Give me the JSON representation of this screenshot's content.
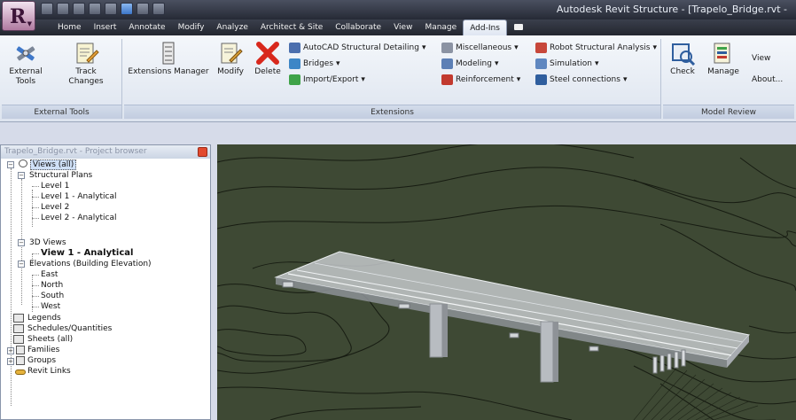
{
  "app": {
    "title": "Autodesk Revit Structure - [Trapelo_Bridge.rvt -"
  },
  "colors": {
    "viewport_bg": "#3f4a35",
    "active_tab_bg": "#e8edf6",
    "close_button": "#e24a2f"
  },
  "tabs": [
    {
      "label": "Home"
    },
    {
      "label": "Insert"
    },
    {
      "label": "Annotate"
    },
    {
      "label": "Modify"
    },
    {
      "label": "Analyze"
    },
    {
      "label": "Architect & Site"
    },
    {
      "label": "Collaborate"
    },
    {
      "label": "View"
    },
    {
      "label": "Manage"
    },
    {
      "label": "Add-Ins",
      "active": true
    }
  ],
  "ribbon": {
    "external_tools_panel": {
      "label": "External Tools",
      "external_tools": {
        "label": "External\nTools",
        "icon": "tools-icon"
      },
      "track_changes": {
        "label": "Track\nChanges",
        "icon": "track-changes-icon"
      }
    },
    "extensions_panel": {
      "label": "Extensions",
      "extensions_manager": {
        "label": "Extensions Manager",
        "icon": "extensions-manager-icon"
      },
      "modify": {
        "label": "Modify",
        "icon": "modify-icon"
      },
      "delete": {
        "label": "Delete",
        "icon": "delete-x-icon"
      },
      "autocad": {
        "label": "AutoCAD Structural Detailing",
        "icon": "autocad-icon"
      },
      "bridges": {
        "label": "Bridges",
        "icon": "bridges-icon"
      },
      "import_export": {
        "label": "Import/Export",
        "icon": "import-export-icon"
      },
      "misc": {
        "label": "Miscellaneous",
        "icon": "miscellaneous-icon"
      },
      "modeling": {
        "label": "Modeling",
        "icon": "modeling-icon"
      },
      "reinforcement": {
        "label": "Reinforcement",
        "icon": "reinforcement-icon"
      },
      "robot": {
        "label": "Robot Structural Analysis",
        "icon": "robot-icon"
      },
      "simulation": {
        "label": "Simulation",
        "icon": "simulation-icon"
      },
      "steel": {
        "label": "Steel connections",
        "icon": "steel-connections-icon"
      }
    },
    "model_review_panel": {
      "label": "Model Review",
      "check": {
        "label": "Check",
        "icon": "check-icon"
      },
      "manage": {
        "label": "Manage",
        "icon": "manage-icon"
      },
      "view": {
        "label": "View\nAbout..."
      }
    }
  },
  "browser": {
    "title": "Trapelo_Bridge.rvt - Project browser",
    "views_all": "Views (all)",
    "structural_plans": "Structural Plans",
    "level1": "Level 1",
    "level1_analytical": "Level 1 - Analytical",
    "level2": "Level 2",
    "level2_analytical": "Level 2 - Analytical",
    "views_3d": "3D Views",
    "view1_analytical": "View 1 - Analytical",
    "elevations": "Elevations (Building Elevation)",
    "east": "East",
    "north": "North",
    "south": "South",
    "west": "West",
    "legends": "Legends",
    "schedules": "Schedules/Quantities",
    "sheets": "Sheets (all)",
    "families": "Families",
    "groups": "Groups",
    "revit_links": "Revit Links"
  }
}
